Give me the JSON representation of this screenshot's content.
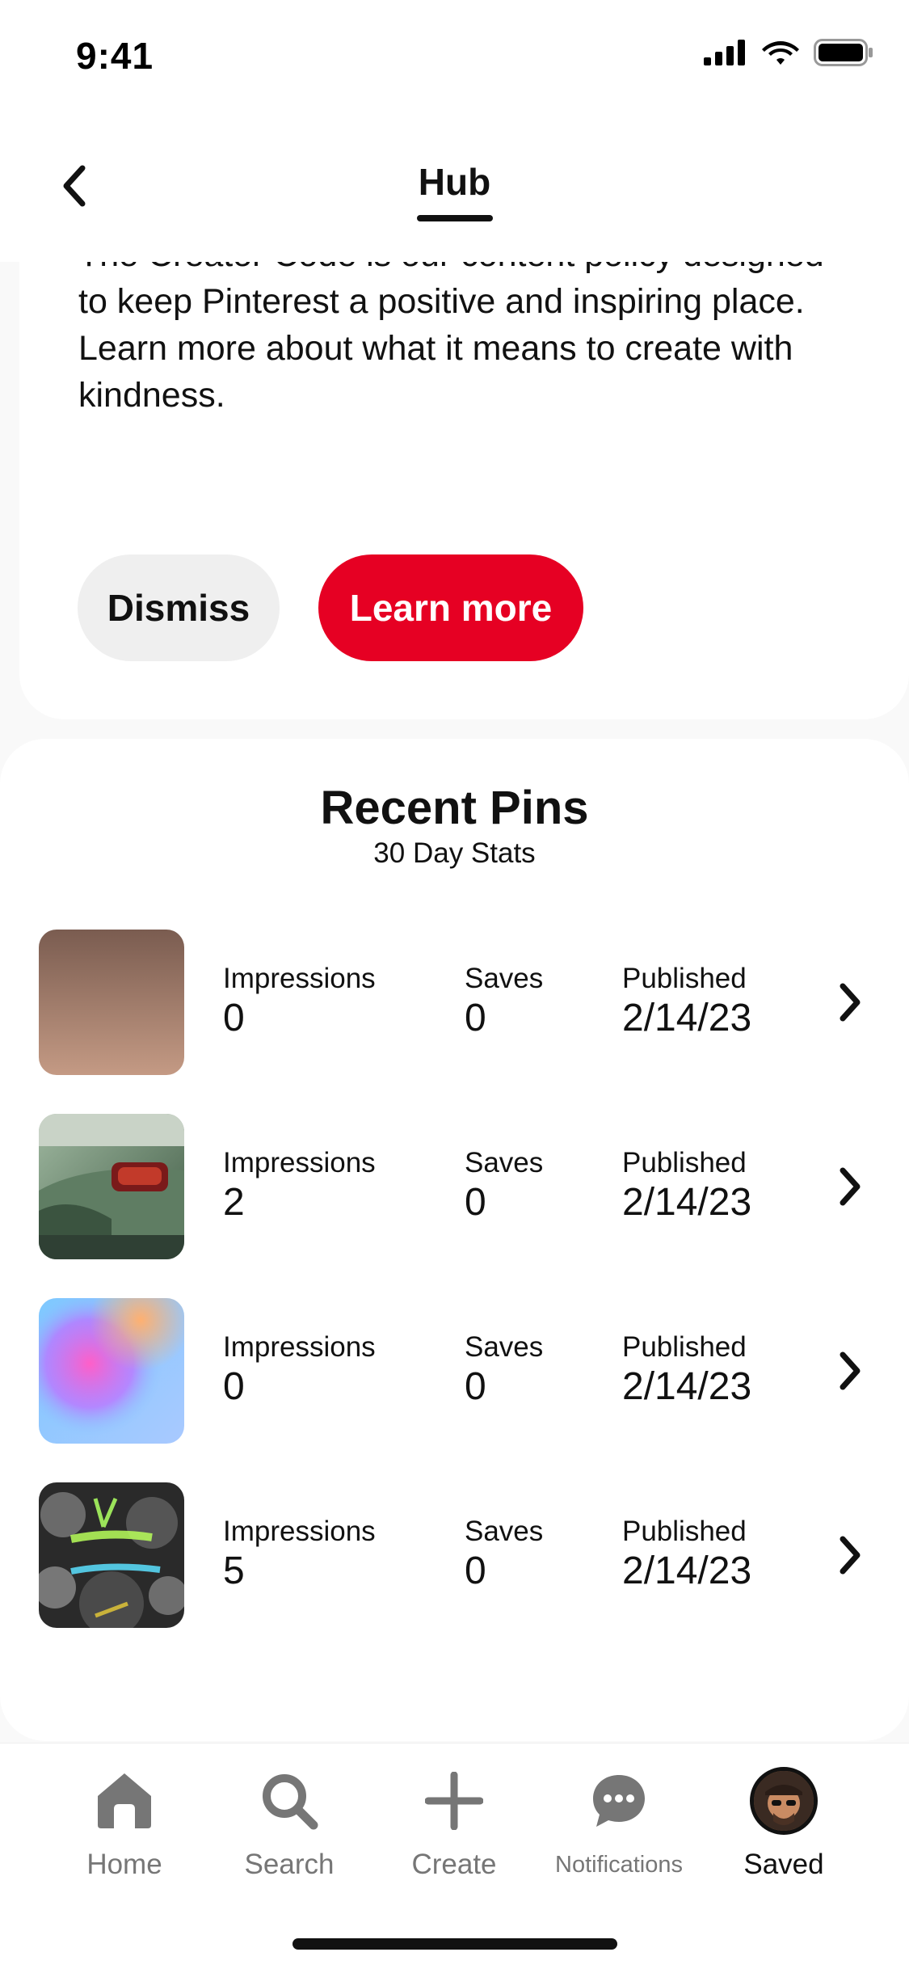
{
  "status_bar": {
    "time": "9:41"
  },
  "header": {
    "title": "Hub",
    "back_icon": "chevron-left-icon"
  },
  "policy_card": {
    "text": "The Creator Code is our content policy designed to keep Pinterest a positive and inspiring place. Learn more about what it means to create with kindness.",
    "dismiss_label": "Dismiss",
    "learn_more_label": "Learn more",
    "accent_color": "#e60023"
  },
  "recent_pins": {
    "title": "Recent Pins",
    "subtitle": "30 Day Stats",
    "label_impressions": "Impressions",
    "label_saves": "Saves",
    "label_published": "Published",
    "pins": [
      {
        "thumb": "brown-gradient",
        "impressions": "0",
        "saves": "0",
        "published": "2/14/23"
      },
      {
        "thumb": "green-car",
        "impressions": "2",
        "saves": "0",
        "published": "2/14/23"
      },
      {
        "thumb": "pink-blue-gradient",
        "impressions": "0",
        "saves": "0",
        "published": "2/14/23"
      },
      {
        "thumb": "less-energy-forest",
        "impressions": "5",
        "saves": "0",
        "published": "2/14/23"
      }
    ]
  },
  "bottom_nav": {
    "items": [
      {
        "label": "Home",
        "icon": "home-icon"
      },
      {
        "label": "Search",
        "icon": "search-icon"
      },
      {
        "label": "Create",
        "icon": "plus-icon"
      },
      {
        "label": "Notifications",
        "icon": "chat-bubble-icon"
      },
      {
        "label": "Saved",
        "icon": "avatar",
        "active": true
      }
    ]
  }
}
